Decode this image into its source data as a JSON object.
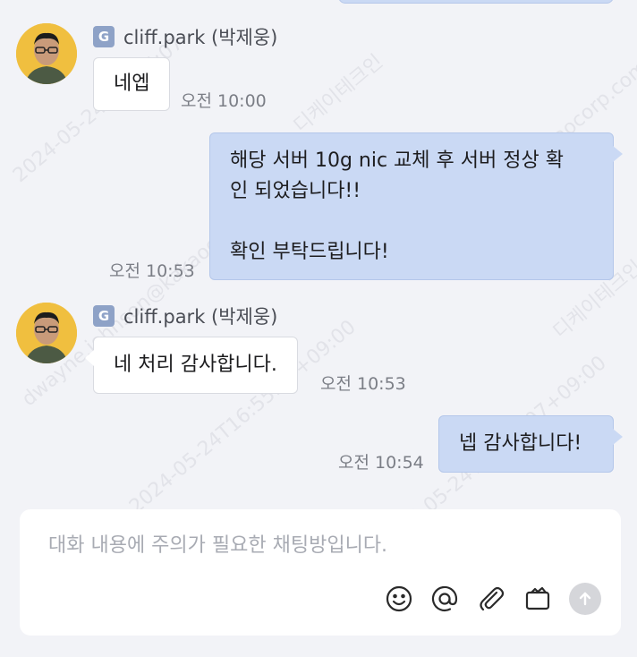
{
  "messages": [
    {
      "sender_badge": "G",
      "sender_name": "cliff.park (박제웅)",
      "text": "네엡",
      "time": "오전 10:00"
    },
    {
      "lines": [
        "해당 서버 10g nic 교체 후 서버 정상 확",
        "인 되었습니다!!",
        "",
        "확인 부탁드립니다!"
      ],
      "time": "오전 10:53"
    },
    {
      "sender_badge": "G",
      "sender_name": "cliff.park (박제웅)",
      "text": "네 처리 감사합니다.",
      "time": "오전 10:53"
    },
    {
      "text": "넵 감사합니다!",
      "time": "오전 10:54"
    }
  ],
  "composer": {
    "placeholder": "대화 내용에 주의가 필요한 채팅방입니다."
  },
  "watermarks": [
    "2024-05-24T16:55:07",
    "디케이테크인",
    "dwayne.johnson@kakaocorp.com",
    "2024-05-24T16:55:07+09:00",
    "dwayne.johnson@kakaocorp.com",
    "2024-05-24T16:55:07+09:00",
    "디케이테크인"
  ],
  "colors": {
    "outgoing_bubble": "#cad9f4",
    "incoming_bubble": "#ffffff",
    "badge": "#8ea2c7",
    "background": "#f2f3f7"
  }
}
